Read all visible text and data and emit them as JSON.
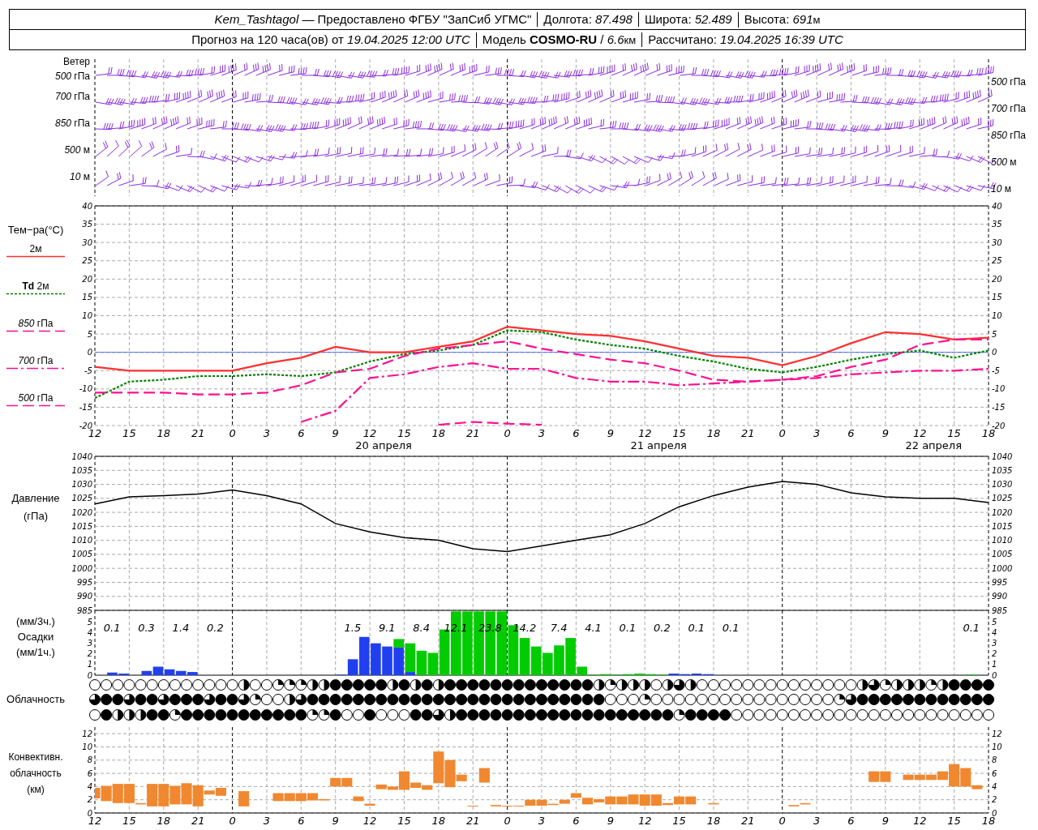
{
  "header": {
    "line1": [
      {
        "text": "*Kem_Tashtagol* — Предоставлено ФГБУ \"ЗапСиб УГМС\""
      },
      {
        "text": "Долгота: *87.498*"
      },
      {
        "text": "Широта: *52.489*"
      },
      {
        "text": "Высота: *691*",
        "unit": "м"
      }
    ],
    "line2": [
      {
        "text": "Прогноз на 120 часа(ов) от *19.04.2025 12:00 UTC*"
      },
      {
        "text": "Модель **COSMO-RU** / *6.6*",
        "unit": "км"
      },
      {
        "text": "Рассчитано: *19.04.2025 16:39 UTC*"
      }
    ]
  },
  "wind": {
    "title": "Ветер",
    "levels": [
      {
        "label": "*500* гПа",
        "right_label": "*500* гПа"
      },
      {
        "label": "*700* гПа",
        "right_label": "*700* гПа"
      },
      {
        "label": "*850* гПа",
        "right_label": "*850* гПа"
      },
      {
        "label": "*500* м",
        "right_label": "*500* м"
      },
      {
        "label": "*10* м",
        "right_label": "*10* м"
      }
    ]
  },
  "temperature": {
    "title": "Тем−ра(°C)",
    "date_labels": [
      "20 апреля",
      "21 апреля",
      "22 апреля"
    ],
    "right_ticks": [
      "40",
      "35",
      "30",
      "25",
      "20",
      "15",
      "10",
      "5",
      "0",
      "-5",
      "-10",
      "-15",
      "-20"
    ],
    "chart_data": {
      "type": "line",
      "grid": true,
      "categories": [
        "12",
        "15",
        "18",
        "21",
        "0",
        "3",
        "6",
        "9",
        "12",
        "15",
        "18",
        "21",
        "0",
        "3",
        "6",
        "9",
        "12",
        "15",
        "18",
        "21",
        "0",
        "3",
        "6",
        "9",
        "12",
        "15",
        "18"
      ],
      "ylim": [
        -20,
        40
      ],
      "yticks": [
        -20,
        -15,
        -10,
        -5,
        0,
        5,
        10,
        15,
        20,
        25,
        30,
        35,
        40
      ],
      "ref_lines": [
        {
          "axis": "y",
          "value": 0,
          "color": "#3050ff"
        }
      ],
      "series": [
        {
          "name": "2м",
          "color": "#ff3030",
          "line_style": "solid",
          "values": [
            -4,
            -5,
            -5,
            -5,
            -5,
            -3,
            -1.5,
            1.5,
            0,
            0,
            1.5,
            3,
            7,
            6,
            5,
            4.5,
            3,
            1,
            -1,
            -1.5,
            -3.5,
            -1,
            2.5,
            5.5,
            5,
            3.5,
            4
          ]
        },
        {
          "name": "**Td** 2м",
          "color": "#008000",
          "line_style": "dotted",
          "values": [
            -12.5,
            -8,
            -7.5,
            -6.5,
            -6.5,
            -6,
            -6.5,
            -5.5,
            -2.5,
            -0.5,
            0.5,
            2,
            6,
            5.5,
            3.5,
            2,
            1,
            -1,
            -2.5,
            -4.5,
            -5.5,
            -4,
            -2,
            -0.5,
            0.5,
            -1.5,
            0.5
          ]
        },
        {
          "name": "*850* гПа",
          "color": "#ff1090",
          "line_style": "dashed",
          "values": [
            -11,
            -11,
            -11,
            -11.5,
            -11.5,
            -11,
            -9,
            -5.5,
            -4.5,
            -1,
            1,
            2,
            3,
            1,
            -0.5,
            -2,
            -3,
            -5,
            -7.5,
            -8,
            -7.5,
            -6.5,
            -4,
            -2,
            2,
            3.5,
            3.5
          ]
        },
        {
          "name": "*700* гПа",
          "color": "#ff1090",
          "line_style": "dashdot",
          "values": [
            null,
            null,
            null,
            null,
            null,
            null,
            -19,
            -16,
            -7,
            -6,
            -4,
            -3,
            -4.5,
            -4.5,
            -7,
            -8,
            -8,
            -9,
            -8.5,
            -8,
            -7.5,
            -7,
            -6,
            -5.5,
            -5,
            -5,
            -4.5
          ]
        },
        {
          "name": "*500* гПа",
          "color": "#ff1090",
          "line_style": "dashed",
          "values": [
            null,
            null,
            null,
            null,
            null,
            null,
            null,
            null,
            null,
            null,
            -19.8,
            -19,
            -19.5,
            -19.8,
            null,
            null,
            null,
            null,
            null,
            null,
            null,
            null,
            null,
            null,
            null,
            null,
            null
          ]
        }
      ]
    }
  },
  "pressure": {
    "title": "Давление",
    "unit": "(гПа)",
    "right_ticks": [
      "1040",
      "1035",
      "1030",
      "1025",
      "1020",
      "1015",
      "1010",
      "1005",
      "1000",
      "995",
      "990",
      "985"
    ],
    "chart_data": {
      "type": "line",
      "grid": true,
      "ylim": [
        985,
        1040
      ],
      "yticks": [
        985,
        990,
        995,
        1000,
        1005,
        1010,
        1015,
        1020,
        1025,
        1030,
        1035,
        1040
      ],
      "series": [
        {
          "color": "#000000",
          "values": [
            1023,
            1025.5,
            1026,
            1026.5,
            1028,
            1026,
            1023,
            1016,
            1013,
            1011,
            1010,
            1007,
            1006,
            1008,
            1010,
            1012,
            1016,
            1022,
            1026,
            1029,
            1031,
            1030,
            1027,
            1025.5,
            1025,
            1025,
            1023.5
          ]
        }
      ]
    }
  },
  "precipitation": {
    "labels": [
      "(мм/3ч.)",
      "Осадки",
      "(мм/1ч.)"
    ],
    "right_ticks": [
      "5",
      "4",
      "3",
      "2",
      "1",
      "0"
    ],
    "total_groups": [
      {
        "totals": [
          "0.1",
          "0.3",
          "1.4",
          "0.2"
        ]
      },
      {
        "totals": [
          "1.5",
          "9.1",
          "8.4",
          "12.1",
          "23.8",
          "14.2",
          "7.4",
          "4.1",
          "0.1",
          "0.2",
          "0.1",
          "0.1"
        ]
      },
      {
        "totals": [
          "0.1"
        ]
      }
    ],
    "chart_data": {
      "type": "bar",
      "stacked": true,
      "grid": true,
      "ylim": [
        0,
        6.1
      ],
      "yticks": [
        0,
        1,
        2,
        3,
        4,
        5
      ],
      "series": [
        {
          "color": "#2040f0",
          "values": [
            0,
            0.25,
            0.15,
            0,
            0.4,
            0.8,
            0.55,
            0.4,
            0.3,
            0,
            0,
            0,
            0,
            0,
            0,
            0,
            0,
            0,
            0,
            0,
            0,
            0.05,
            1.5,
            3.6,
            3,
            2.7,
            2.6,
            0.3,
            0,
            0,
            0,
            0,
            0,
            0,
            0,
            0,
            0,
            0,
            0,
            0,
            0,
            0,
            0,
            0,
            0,
            0,
            0,
            0,
            0,
            0,
            0.15,
            0.1,
            0.15,
            0.1,
            0,
            0,
            0,
            0,
            0,
            0,
            0,
            0,
            0,
            0,
            0,
            0,
            0,
            0,
            0,
            0,
            0,
            0,
            0,
            0,
            0,
            0,
            0,
            0
          ]
        },
        {
          "color": "#00cc00",
          "values": [
            0,
            0,
            0,
            0,
            0,
            0,
            0,
            0,
            0,
            0,
            0,
            0,
            0,
            0,
            0,
            0,
            0,
            0,
            0,
            0,
            0,
            0,
            0,
            0,
            0,
            0,
            0.8,
            2.7,
            2.3,
            2.1,
            4.3,
            6,
            6,
            6,
            6,
            6,
            4.7,
            3.5,
            2.7,
            2.1,
            2.8,
            3.5,
            0.8,
            0.05,
            0.1,
            0.05,
            0.1,
            0.15,
            0.1,
            0.05,
            0,
            0,
            0,
            0,
            0,
            0,
            0,
            0,
            0,
            0,
            0,
            0,
            0,
            0,
            0,
            0,
            0,
            0,
            0,
            0,
            0,
            0,
            0,
            0,
            0,
            0,
            0.05,
            0
          ]
        }
      ]
    }
  },
  "cloudiness": {
    "title": "Облачность",
    "rows": [
      {
        "cells": [
          {
            "kind": "clear"
          },
          {
            "kind": "clear"
          },
          {
            "kind": "clear"
          },
          {
            "kind": "clear"
          },
          {
            "kind": "clear"
          },
          {
            "kind": "clear"
          },
          {
            "kind": "clear"
          },
          {
            "kind": "clear"
          },
          {
            "kind": "clear"
          },
          {
            "kind": "clear"
          },
          {
            "kind": "clear"
          },
          {
            "kind": "clear"
          },
          {
            "kind": "clear"
          },
          {
            "kind": "half"
          },
          {
            "kind": "clear"
          },
          {
            "kind": "clear"
          },
          {
            "kind": "quarter"
          },
          {
            "kind": "quarter"
          },
          {
            "kind": "quarter"
          },
          {
            "kind": "half"
          },
          {
            "kind": "half"
          },
          {
            "kind": "overcast"
          },
          {
            "kind": "overcast"
          },
          {
            "kind": "overcast"
          },
          {
            "kind": "overcast"
          },
          {
            "kind": "overcast"
          },
          {
            "kind": "half"
          },
          {
            "kind": "overcast"
          },
          {
            "kind": "half"
          },
          {
            "kind": "overcast"
          },
          {
            "kind": "half"
          },
          {
            "kind": "overcast"
          },
          {
            "kind": "overcast"
          },
          {
            "kind": "overcast"
          },
          {
            "kind": "overcast"
          },
          {
            "kind": "overcast"
          },
          {
            "kind": "overcast"
          },
          {
            "kind": "overcast"
          },
          {
            "kind": "overcast"
          },
          {
            "kind": "overcast"
          },
          {
            "kind": "overcast"
          },
          {
            "kind": "overcast"
          },
          {
            "kind": "overcast"
          },
          {
            "kind": "overcast"
          },
          {
            "kind": "half"
          },
          {
            "kind": "quarter"
          },
          {
            "kind": "half"
          },
          {
            "kind": "half"
          },
          {
            "kind": "half"
          },
          {
            "kind": "clear"
          },
          {
            "kind": "half"
          },
          {
            "kind": "most"
          },
          {
            "kind": "half"
          },
          {
            "kind": "clear"
          },
          {
            "kind": "clear"
          },
          {
            "kind": "clear"
          },
          {
            "kind": "clear"
          },
          {
            "kind": "clear"
          },
          {
            "kind": "clear"
          },
          {
            "kind": "clear"
          },
          {
            "kind": "clear"
          },
          {
            "kind": "clear"
          },
          {
            "kind": "clear"
          },
          {
            "kind": "clear"
          },
          {
            "kind": "clear"
          },
          {
            "kind": "clear"
          },
          {
            "kind": "clear"
          },
          {
            "kind": "half"
          },
          {
            "kind": "most"
          },
          {
            "kind": "quarter"
          },
          {
            "kind": "half"
          },
          {
            "kind": "half"
          },
          {
            "kind": "half"
          },
          {
            "kind": "quarter"
          },
          {
            "kind": "half"
          },
          {
            "kind": "overcast"
          },
          {
            "kind": "overcast"
          },
          {
            "kind": "overcast"
          },
          {
            "kind": "overcast"
          }
        ]
      },
      {
        "cells": [
          {
            "kind": "most"
          },
          {
            "kind": "overcast"
          },
          {
            "kind": "overcast"
          },
          {
            "kind": "most"
          },
          {
            "kind": "overcast"
          },
          {
            "kind": "overcast"
          },
          {
            "kind": "most"
          },
          {
            "kind": "overcast"
          },
          {
            "kind": "overcast"
          },
          {
            "kind": "overcast"
          },
          {
            "kind": "most"
          },
          {
            "kind": "overcast"
          },
          {
            "kind": "overcast"
          },
          {
            "kind": "most"
          },
          {
            "kind": "quarter"
          },
          {
            "kind": "clear"
          },
          {
            "kind": "clear"
          },
          {
            "kind": "half"
          },
          {
            "kind": "most"
          },
          {
            "kind": "overcast"
          },
          {
            "kind": "overcast"
          },
          {
            "kind": "overcast"
          },
          {
            "kind": "overcast"
          },
          {
            "kind": "overcast"
          },
          {
            "kind": "overcast"
          },
          {
            "kind": "overcast"
          },
          {
            "kind": "overcast"
          },
          {
            "kind": "overcast"
          },
          {
            "kind": "overcast"
          },
          {
            "kind": "overcast"
          },
          {
            "kind": "overcast"
          },
          {
            "kind": "overcast"
          },
          {
            "kind": "overcast"
          },
          {
            "kind": "overcast"
          },
          {
            "kind": "overcast"
          },
          {
            "kind": "overcast"
          },
          {
            "kind": "overcast"
          },
          {
            "kind": "overcast"
          },
          {
            "kind": "overcast"
          },
          {
            "kind": "overcast"
          },
          {
            "kind": "overcast"
          },
          {
            "kind": "overcast"
          },
          {
            "kind": "overcast"
          },
          {
            "kind": "overcast"
          },
          {
            "kind": "overcast"
          },
          {
            "kind": "clear"
          },
          {
            "kind": "clear"
          },
          {
            "kind": "clear"
          },
          {
            "kind": "quarter"
          },
          {
            "kind": "clear"
          },
          {
            "kind": "clear"
          },
          {
            "kind": "clear"
          },
          {
            "kind": "clear"
          },
          {
            "kind": "clear"
          },
          {
            "kind": "clear"
          },
          {
            "kind": "clear"
          },
          {
            "kind": "clear"
          },
          {
            "kind": "clear"
          },
          {
            "kind": "clear"
          },
          {
            "kind": "clear"
          },
          {
            "kind": "clear"
          },
          {
            "kind": "clear"
          },
          {
            "kind": "clear"
          },
          {
            "kind": "clear"
          },
          {
            "kind": "clear"
          },
          {
            "kind": "quarter"
          },
          {
            "kind": "most"
          },
          {
            "kind": "overcast"
          },
          {
            "kind": "overcast"
          },
          {
            "kind": "overcast"
          },
          {
            "kind": "overcast"
          },
          {
            "kind": "overcast"
          },
          {
            "kind": "overcast"
          },
          {
            "kind": "overcast"
          },
          {
            "kind": "overcast"
          },
          {
            "kind": "overcast"
          },
          {
            "kind": "overcast"
          },
          {
            "kind": "overcast"
          },
          {
            "kind": "overcast"
          }
        ]
      },
      {
        "cells": [
          {
            "kind": "clear"
          },
          {
            "kind": "overcast"
          },
          {
            "kind": "half"
          },
          {
            "kind": "half"
          },
          {
            "kind": "half"
          },
          {
            "kind": "overcast"
          },
          {
            "kind": "overcast"
          },
          {
            "kind": "quarter"
          },
          {
            "kind": "overcast"
          },
          {
            "kind": "overcast"
          },
          {
            "kind": "overcast"
          },
          {
            "kind": "overcast"
          },
          {
            "kind": "overcast"
          },
          {
            "kind": "overcast"
          },
          {
            "kind": "overcast"
          },
          {
            "kind": "overcast"
          },
          {
            "kind": "overcast"
          },
          {
            "kind": "overcast"
          },
          {
            "kind": "overcast"
          },
          {
            "kind": "quarter"
          },
          {
            "kind": "quarter"
          },
          {
            "kind": "overcast"
          },
          {
            "kind": "clear"
          },
          {
            "kind": "clear"
          },
          {
            "kind": "overcast"
          },
          {
            "kind": "clear"
          },
          {
            "kind": "clear"
          },
          {
            "kind": "clear"
          },
          {
            "kind": "overcast"
          },
          {
            "kind": "overcast"
          },
          {
            "kind": "most"
          },
          {
            "kind": "half"
          },
          {
            "kind": "overcast"
          },
          {
            "kind": "overcast"
          },
          {
            "kind": "overcast"
          },
          {
            "kind": "overcast"
          },
          {
            "kind": "overcast"
          },
          {
            "kind": "overcast"
          },
          {
            "kind": "overcast"
          },
          {
            "kind": "overcast"
          },
          {
            "kind": "overcast"
          },
          {
            "kind": "overcast"
          },
          {
            "kind": "overcast"
          },
          {
            "kind": "overcast"
          },
          {
            "kind": "overcast"
          },
          {
            "kind": "overcast"
          },
          {
            "kind": "overcast"
          },
          {
            "kind": "overcast"
          },
          {
            "kind": "overcast"
          },
          {
            "kind": "overcast"
          },
          {
            "kind": "overcast"
          },
          {
            "kind": "quarter"
          },
          {
            "kind": "overcast"
          },
          {
            "kind": "overcast"
          },
          {
            "kind": "overcast"
          },
          {
            "kind": "overcast"
          },
          {
            "kind": "clear"
          },
          {
            "kind": "clear"
          },
          {
            "kind": "clear"
          },
          {
            "kind": "clear"
          },
          {
            "kind": "clear"
          },
          {
            "kind": "clear"
          },
          {
            "kind": "clear"
          },
          {
            "kind": "clear"
          },
          {
            "kind": "clear"
          },
          {
            "kind": "clear"
          },
          {
            "kind": "clear"
          },
          {
            "kind": "clear"
          },
          {
            "kind": "clear"
          },
          {
            "kind": "clear"
          },
          {
            "kind": "clear"
          },
          {
            "kind": "clear"
          },
          {
            "kind": "clear"
          },
          {
            "kind": "clear"
          },
          {
            "kind": "clear"
          },
          {
            "kind": "clear"
          },
          {
            "kind": "clear"
          },
          {
            "kind": "clear"
          },
          {
            "kind": "clear"
          }
        ]
      }
    ]
  },
  "convective": {
    "labels": [
      "Конвективн.",
      "облачность",
      "(км)"
    ],
    "right_ticks": [
      "12",
      "10",
      "8",
      "6",
      "4",
      "2",
      "0"
    ],
    "chart_data": {
      "type": "candlestick",
      "grid": true,
      "ylim": [
        0,
        13
      ],
      "yticks": [
        0,
        2,
        4,
        6,
        8,
        10,
        12
      ],
      "categories": [
        "12",
        null,
        null,
        "15",
        null,
        null,
        "18",
        null,
        null,
        "21",
        null,
        null,
        "0",
        null,
        null,
        "3",
        null,
        null,
        "6",
        null,
        null,
        "9",
        null,
        null,
        "12",
        null,
        null,
        "15",
        null,
        null,
        "18",
        null,
        null,
        "21",
        null,
        null,
        "0",
        null,
        null,
        "3",
        null,
        null,
        "6",
        null,
        null,
        "9",
        null,
        null,
        "12",
        null,
        null,
        "15",
        null,
        null,
        "18",
        null,
        null,
        "21",
        null,
        null,
        "0",
        null,
        null,
        "3",
        null,
        null,
        "6",
        null,
        null,
        "9",
        null,
        null,
        "12",
        null,
        null,
        "15",
        null,
        null,
        "18"
      ],
      "series": [
        {
          "color": "#f08830",
          "ohlc": [
            [
              2.2,
              3.8,
              2.2,
              3.8
            ],
            [
              1.8,
              4.1,
              1.8,
              4.1
            ],
            [
              1.5,
              4.4,
              1.5,
              4.4
            ],
            [
              1.5,
              4.4,
              1.5,
              4.4
            ],
            [
              1.3,
              1.5,
              1.3,
              1.5
            ],
            [
              1,
              4.4,
              1,
              4.4
            ],
            [
              1,
              4.4,
              1,
              4.4
            ],
            [
              1.3,
              4.1,
              1.3,
              4.1
            ],
            [
              1.3,
              4.5,
              1.3,
              4.5
            ],
            [
              1,
              4.2,
              1,
              4.2
            ],
            [
              2.8,
              3.4,
              2.8,
              3.4
            ],
            [
              2.6,
              3.8,
              2.6,
              3.8
            ],
            null,
            [
              1,
              3.3,
              1,
              3.3
            ],
            null,
            null,
            [
              1.8,
              3,
              1.8,
              3
            ],
            [
              1.8,
              3,
              1.8,
              3
            ],
            [
              1.8,
              3,
              1.8,
              3
            ],
            [
              1.9,
              3,
              1.9,
              3
            ],
            [
              1.9,
              2.1,
              1.9,
              2.1
            ],
            [
              4,
              5.3,
              4,
              5.3
            ],
            [
              4,
              5.3,
              4,
              5.3
            ],
            [
              1.8,
              2.5,
              1.8,
              2.5
            ],
            [
              1.1,
              1.4,
              1.1,
              1.4
            ],
            [
              3.6,
              4.3,
              3.6,
              4.3
            ],
            [
              3.5,
              4,
              3.5,
              4
            ],
            [
              3.5,
              6.3,
              3.5,
              6.3
            ],
            [
              3.8,
              4.6,
              3.8,
              4.6
            ],
            [
              3.5,
              4.2,
              3.5,
              4.2
            ],
            [
              4.5,
              9.3,
              4.5,
              9.3
            ],
            [
              3.9,
              8,
              3.9,
              8
            ],
            [
              4.8,
              5.8,
              4.8,
              5.8
            ],
            [
              1,
              1.1,
              1,
              1.1
            ],
            [
              4.6,
              6.8,
              4.6,
              6.8
            ],
            [
              1,
              1.2,
              1,
              1.2
            ],
            [
              1,
              1.1,
              1,
              1.1
            ],
            [
              1,
              1.1,
              1,
              1.1
            ],
            [
              1.1,
              2,
              1.1,
              2
            ],
            [
              1.1,
              2,
              1.1,
              2
            ],
            [
              1.2,
              1.4,
              1.2,
              1.4
            ],
            [
              1.4,
              2,
              1.4,
              2
            ],
            [
              2.3,
              3,
              2.3,
              3
            ],
            [
              1.3,
              2.3,
              1.3,
              2.3
            ],
            [
              1.6,
              2.1,
              1.6,
              2.1
            ],
            [
              1.3,
              2.5,
              1.3,
              2.5
            ],
            [
              1.3,
              2.5,
              1.3,
              2.5
            ],
            [
              1.3,
              2.8,
              1.3,
              2.8
            ],
            [
              1.1,
              2.8,
              1.1,
              2.8
            ],
            [
              1.1,
              2.8,
              1.1,
              2.8
            ],
            [
              1.2,
              1.5,
              1.2,
              1.5
            ],
            [
              1.3,
              2.5,
              1.3,
              2.5
            ],
            [
              1.3,
              2.5,
              1.3,
              2.5
            ],
            null,
            [
              1.3,
              1.5,
              1.3,
              1.5
            ],
            null,
            null,
            null,
            null,
            null,
            null,
            [
              1,
              1.2,
              1,
              1.2
            ],
            [
              1.3,
              1.5,
              1.3,
              1.5
            ],
            null,
            null,
            null,
            null,
            null,
            [
              4.7,
              6.3,
              4.7,
              6.3
            ],
            [
              4.7,
              6.3,
              4.7,
              6.3
            ],
            null,
            [
              5,
              5.8,
              5,
              5.8
            ],
            [
              5,
              5.8,
              5,
              5.8
            ],
            [
              5,
              5.8,
              5,
              5.8
            ],
            [
              5,
              6.3,
              5,
              6.3
            ],
            [
              4,
              7.4,
              4,
              7.4
            ],
            [
              4,
              6.8,
              4,
              6.8
            ],
            [
              3.6,
              4.2,
              3.6,
              4.2
            ],
            null
          ]
        }
      ]
    }
  }
}
